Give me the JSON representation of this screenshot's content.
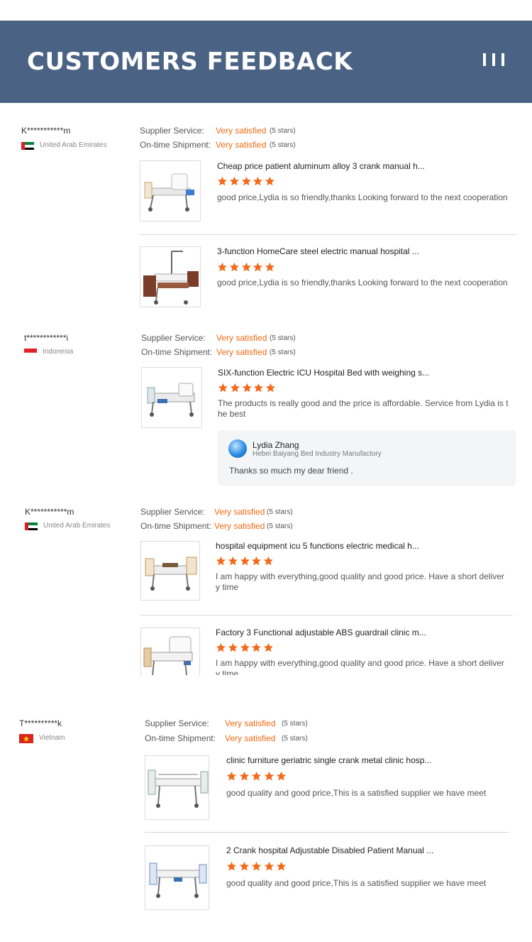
{
  "header": {
    "title": "CUSTOMERS FEEDBACK"
  },
  "reviews": [
    {
      "buyer": "K***********m",
      "country": "United Arab Emirates",
      "flag": "uae",
      "supplier_label": "Supplier Service:",
      "supplier_value": "Very satisfied",
      "supplier_stars": "(5 stars)",
      "shipment_label": "On-time Shipment:",
      "shipment_value": "Very satisfied",
      "shipment_stars": "(5 stars)",
      "products": [
        {
          "name": "Cheap price patient aluminum alloy 3 crank manual h...",
          "rating": 5,
          "comment": "good price,Lydia is so friendly,thanks Looking forward to the next cooperation"
        },
        {
          "name": "3-function HomeCare steel electric manual hospital ...",
          "rating": 5,
          "comment": "good price,Lydia is so friendly,thanks Looking forward to the next cooperation"
        }
      ]
    },
    {
      "buyer": "t************i",
      "country": "Indonesia",
      "flag": "indonesia",
      "supplier_label": "Supplier Service:",
      "supplier_value": "Very satisfied",
      "supplier_stars": "(5 stars)",
      "shipment_label": "On-time Shipment:",
      "shipment_value": "Very satisfied",
      "shipment_stars": "(5 stars)",
      "products": [
        {
          "name": "SIX-function Electric ICU Hospital Bed with weighing s...",
          "rating": 5,
          "comment": "The products is really good and the price is affordable. Service from Lydia is the best"
        }
      ],
      "reply": {
        "name": "Lydia Zhang",
        "company": "Hebei Baiyang Bed Industry Manufactory",
        "text": "Thanks so much my dear friend ."
      }
    },
    {
      "buyer": "K***********m",
      "country": "United Arab Emirates",
      "flag": "uae",
      "supplier_label": "Supplier Service:",
      "supplier_value": "Very satisfied",
      "supplier_stars": "(5 stars)",
      "shipment_label": "On-time Shipment:",
      "shipment_value": "Very satisfied",
      "shipment_stars": "(5 stars)",
      "products": [
        {
          "name": "hospital equipment icu 5 functions electric medical h...",
          "rating": 5,
          "comment": "I am happy with everything,good quality and good price. Have a short delivery time"
        },
        {
          "name": "Factory 3 Functional adjustable ABS guardrail clinic m...",
          "rating": 5,
          "comment": "I am happy with everything,good quality and good price. Have a short delivery time"
        }
      ]
    },
    {
      "buyer": "T**********k",
      "country": "Vietnam",
      "flag": "vietnam",
      "supplier_label": "Supplier Service:",
      "supplier_value": "Very satisfied",
      "supplier_stars": "(5 stars)",
      "shipment_label": "On-time Shipment:",
      "shipment_value": "Very satisfied",
      "shipment_stars": "(5 stars)",
      "products": [
        {
          "name": "clinic furniture geriatric single crank metal clinic hosp...",
          "rating": 5,
          "comment": "good quality and good price,This is a satisfied supplier we have meet"
        },
        {
          "name": "2 Crank hospital Adjustable Disabled Patient Manual ...",
          "rating": 5,
          "comment": "good quality and good price,This is a satisfied supplier we have meet"
        }
      ]
    }
  ],
  "colors": {
    "header_bg": "#4a6384",
    "accent": "#f06a12",
    "star": "#f26a1b"
  }
}
